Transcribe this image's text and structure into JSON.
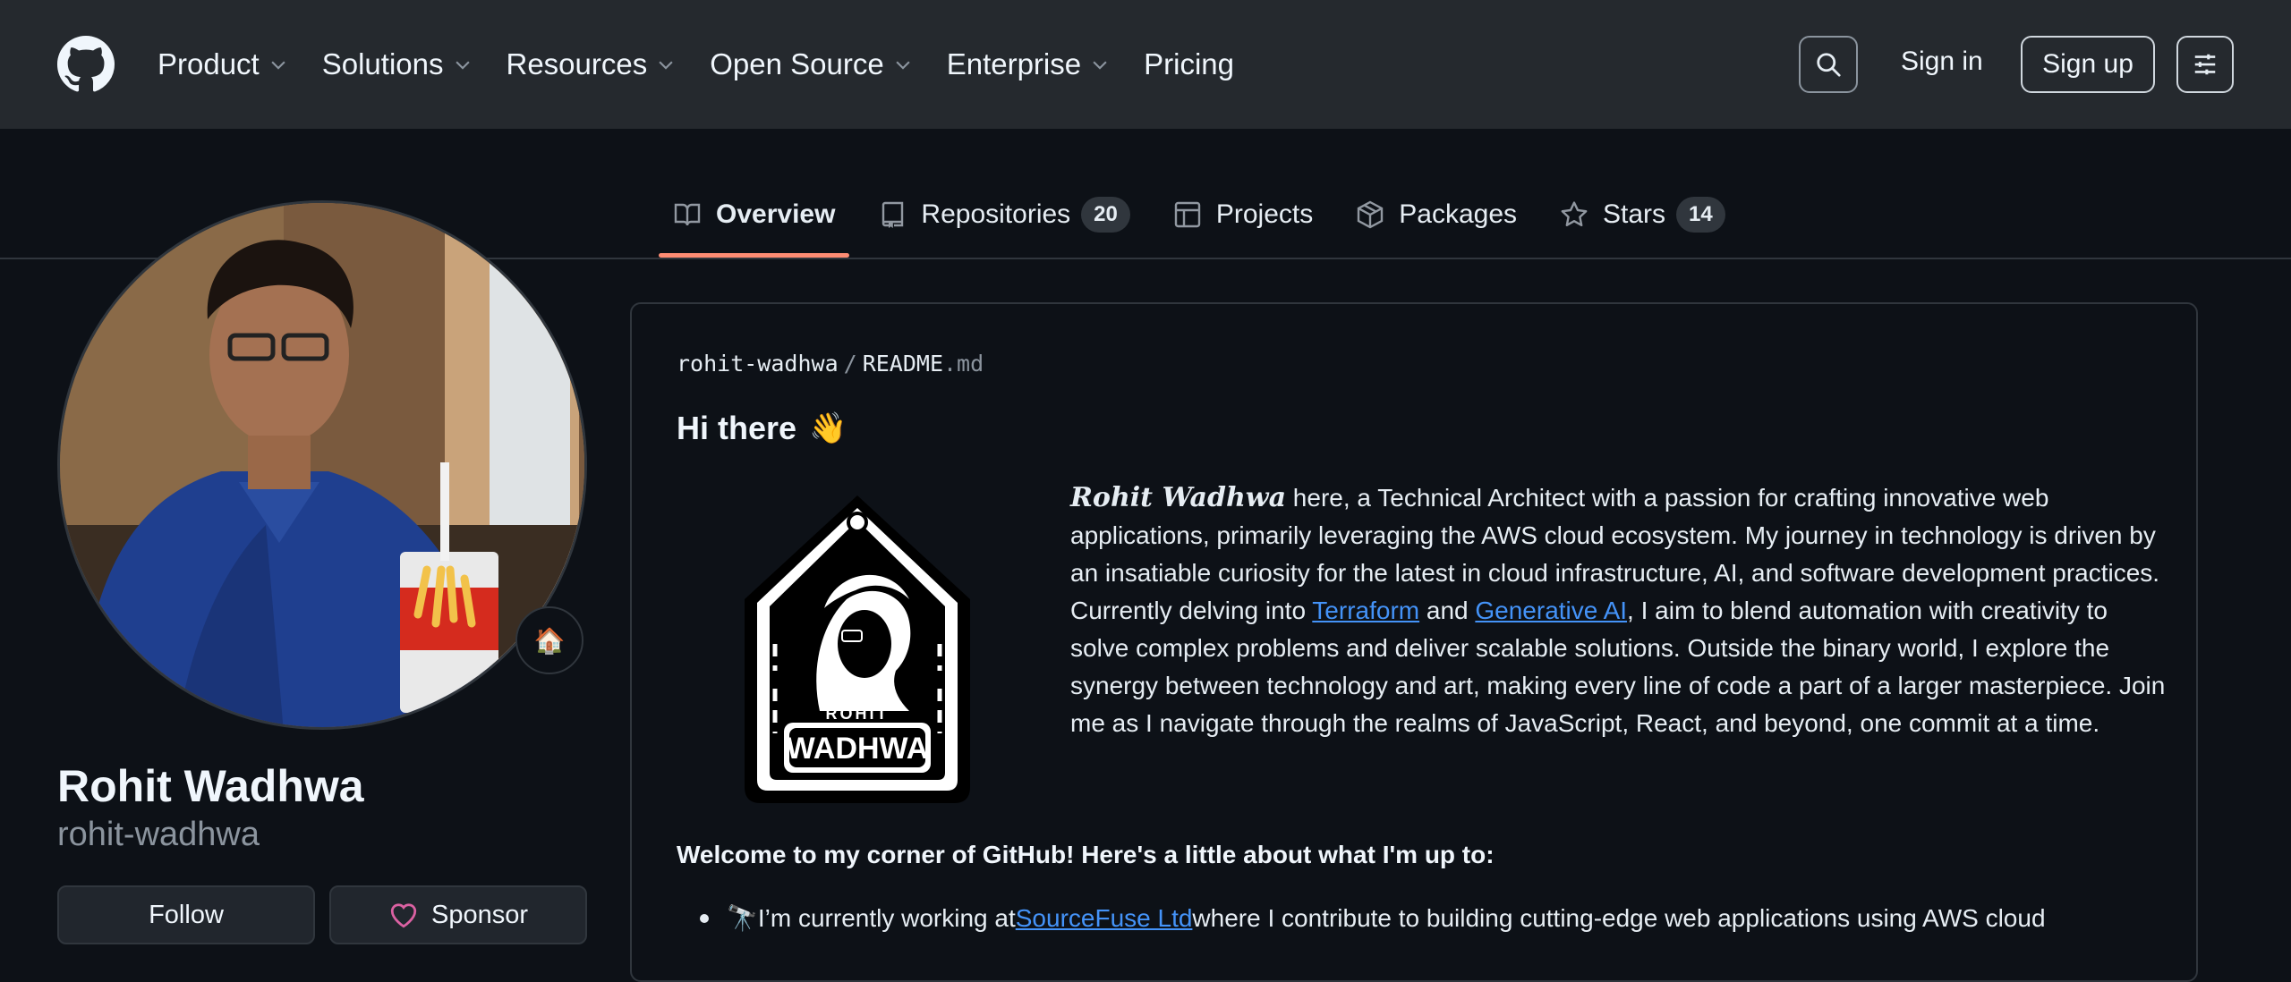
{
  "header": {
    "nav": [
      {
        "label": "Product",
        "dropdown": true
      },
      {
        "label": "Solutions",
        "dropdown": true
      },
      {
        "label": "Resources",
        "dropdown": true
      },
      {
        "label": "Open Source",
        "dropdown": true
      },
      {
        "label": "Enterprise",
        "dropdown": true
      },
      {
        "label": "Pricing",
        "dropdown": false
      }
    ],
    "signin_label": "Sign in",
    "signup_label": "Sign up"
  },
  "tabs": [
    {
      "label": "Overview",
      "icon": "book-icon",
      "active": true
    },
    {
      "label": "Repositories",
      "icon": "repo-icon",
      "count": "20"
    },
    {
      "label": "Projects",
      "icon": "table-icon"
    },
    {
      "label": "Packages",
      "icon": "package-icon"
    },
    {
      "label": "Stars",
      "icon": "star-icon",
      "count": "14"
    }
  ],
  "profile": {
    "fullname": "Rohit Wadhwa",
    "username": "rohit-wadhwa",
    "status_emoji": "🏠",
    "follow_label": "Follow",
    "sponsor_label": "Sponsor"
  },
  "readme": {
    "path_owner": "rohit-wadhwa",
    "path_sep": "/",
    "path_file": "README",
    "path_ext": ".md",
    "greeting": "Hi there",
    "wave": "👋",
    "badge_line1": "ROHIT",
    "badge_line2": "WADHWA",
    "bio": {
      "name": "Rohit Wadhwa",
      "part1": " here, a Technical Architect with a passion for crafting innovative web applications, primarily leveraging the AWS cloud ecosystem. My journey in technology is driven by an insatiable curiosity for the latest in cloud infrastructure, AI, and software development practices. Currently delving into ",
      "link1": "Terraform",
      "part2": " and ",
      "link2": "Generative AI",
      "part3": ", I aim to blend automation with creativity to solve complex problems and deliver scalable solutions. Outside the binary world, I explore the synergy between technology and art, making every line of code a part of a larger masterpiece. Join me as I navigate through the realms of JavaScript, React, and beyond, one commit at a time."
    },
    "welcome": "Welcome to my corner of GitHub! Here's a little about what I'm up to:",
    "list": {
      "emoji": "🔭",
      "text1": " I’m currently working at ",
      "link": "SourceFuse Ltd",
      "text2": " where I contribute to building cutting-edge web applications using AWS cloud"
    }
  },
  "colors": {
    "header_bg": "#25292e",
    "page_bg": "#0d1117",
    "link": "#4493f8",
    "tab_underline": "#fd8c73",
    "sponsor_heart": "#db61a2"
  }
}
